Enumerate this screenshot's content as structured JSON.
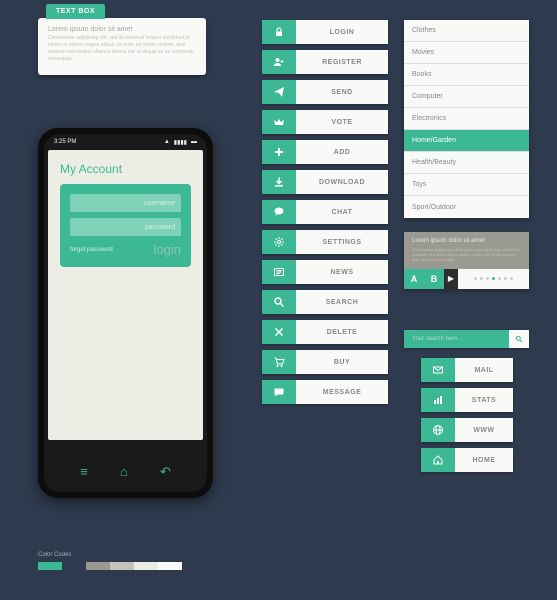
{
  "textbox": {
    "tab": "TEXT BOX",
    "title": "Lorem ipsum dolor sit amet",
    "body": "Consectetur adipiscing elit, sed do eiusmod tempor incididunt ut labore et dolore magna aliqua. Ut enim ad minim veniam, quis nostrud exercitation ullamco laboris nisi ut aliquip ex ea commodo consequat."
  },
  "phone": {
    "time": "3:25 PM",
    "title": "My Account",
    "username_ph": "username",
    "password_ph": "password",
    "forgot": "forgot password",
    "login": "login"
  },
  "color_label": "Color Codes",
  "colors": [
    "#3cb894",
    "#2e3a4d",
    "#9a9a92",
    "#c4c4ba",
    "#eceee5",
    "#f9f9f7"
  ],
  "buttons": [
    {
      "label": "LOGIN",
      "icon": "lock"
    },
    {
      "label": "REGISTER",
      "icon": "user-plus"
    },
    {
      "label": "SEND",
      "icon": "paper-plane"
    },
    {
      "label": "VOTE",
      "icon": "crown"
    },
    {
      "label": "ADD",
      "icon": "plus"
    },
    {
      "label": "DOWNLOAD",
      "icon": "download"
    },
    {
      "label": "CHAT",
      "icon": "chat"
    },
    {
      "label": "SETTINGS",
      "icon": "gear"
    },
    {
      "label": "NEWS",
      "icon": "news"
    },
    {
      "label": "SEARCH",
      "icon": "search"
    },
    {
      "label": "DELETE",
      "icon": "x"
    },
    {
      "label": "BUY",
      "icon": "cart"
    },
    {
      "label": "MESSAGE",
      "icon": "message"
    }
  ],
  "categories": [
    "Clothes",
    "Movies",
    "Books",
    "Computer",
    "Electronics",
    "Home/Garden",
    "Health/Beauty",
    "Toys",
    "Sport/Outdoor"
  ],
  "active_category": "Home/Garden",
  "tabcard": {
    "title": "Lorem ipsum dolor sit amet",
    "body": "Consectetur adipiscing elit sed do eiusmod tempor incididunt ut labore et dolore magna aliqua ut enim ad minim veniam quis nostrud exercitation",
    "tabs": [
      "A",
      "B"
    ],
    "active_dot": 3,
    "dot_count": 7
  },
  "search": {
    "placeholder": "Your search here..."
  },
  "buttons2": [
    {
      "label": "MAIL",
      "icon": "mail"
    },
    {
      "label": "STATS",
      "icon": "stats"
    },
    {
      "label": "WWW",
      "icon": "globe"
    },
    {
      "label": "HOME",
      "icon": "home"
    }
  ]
}
